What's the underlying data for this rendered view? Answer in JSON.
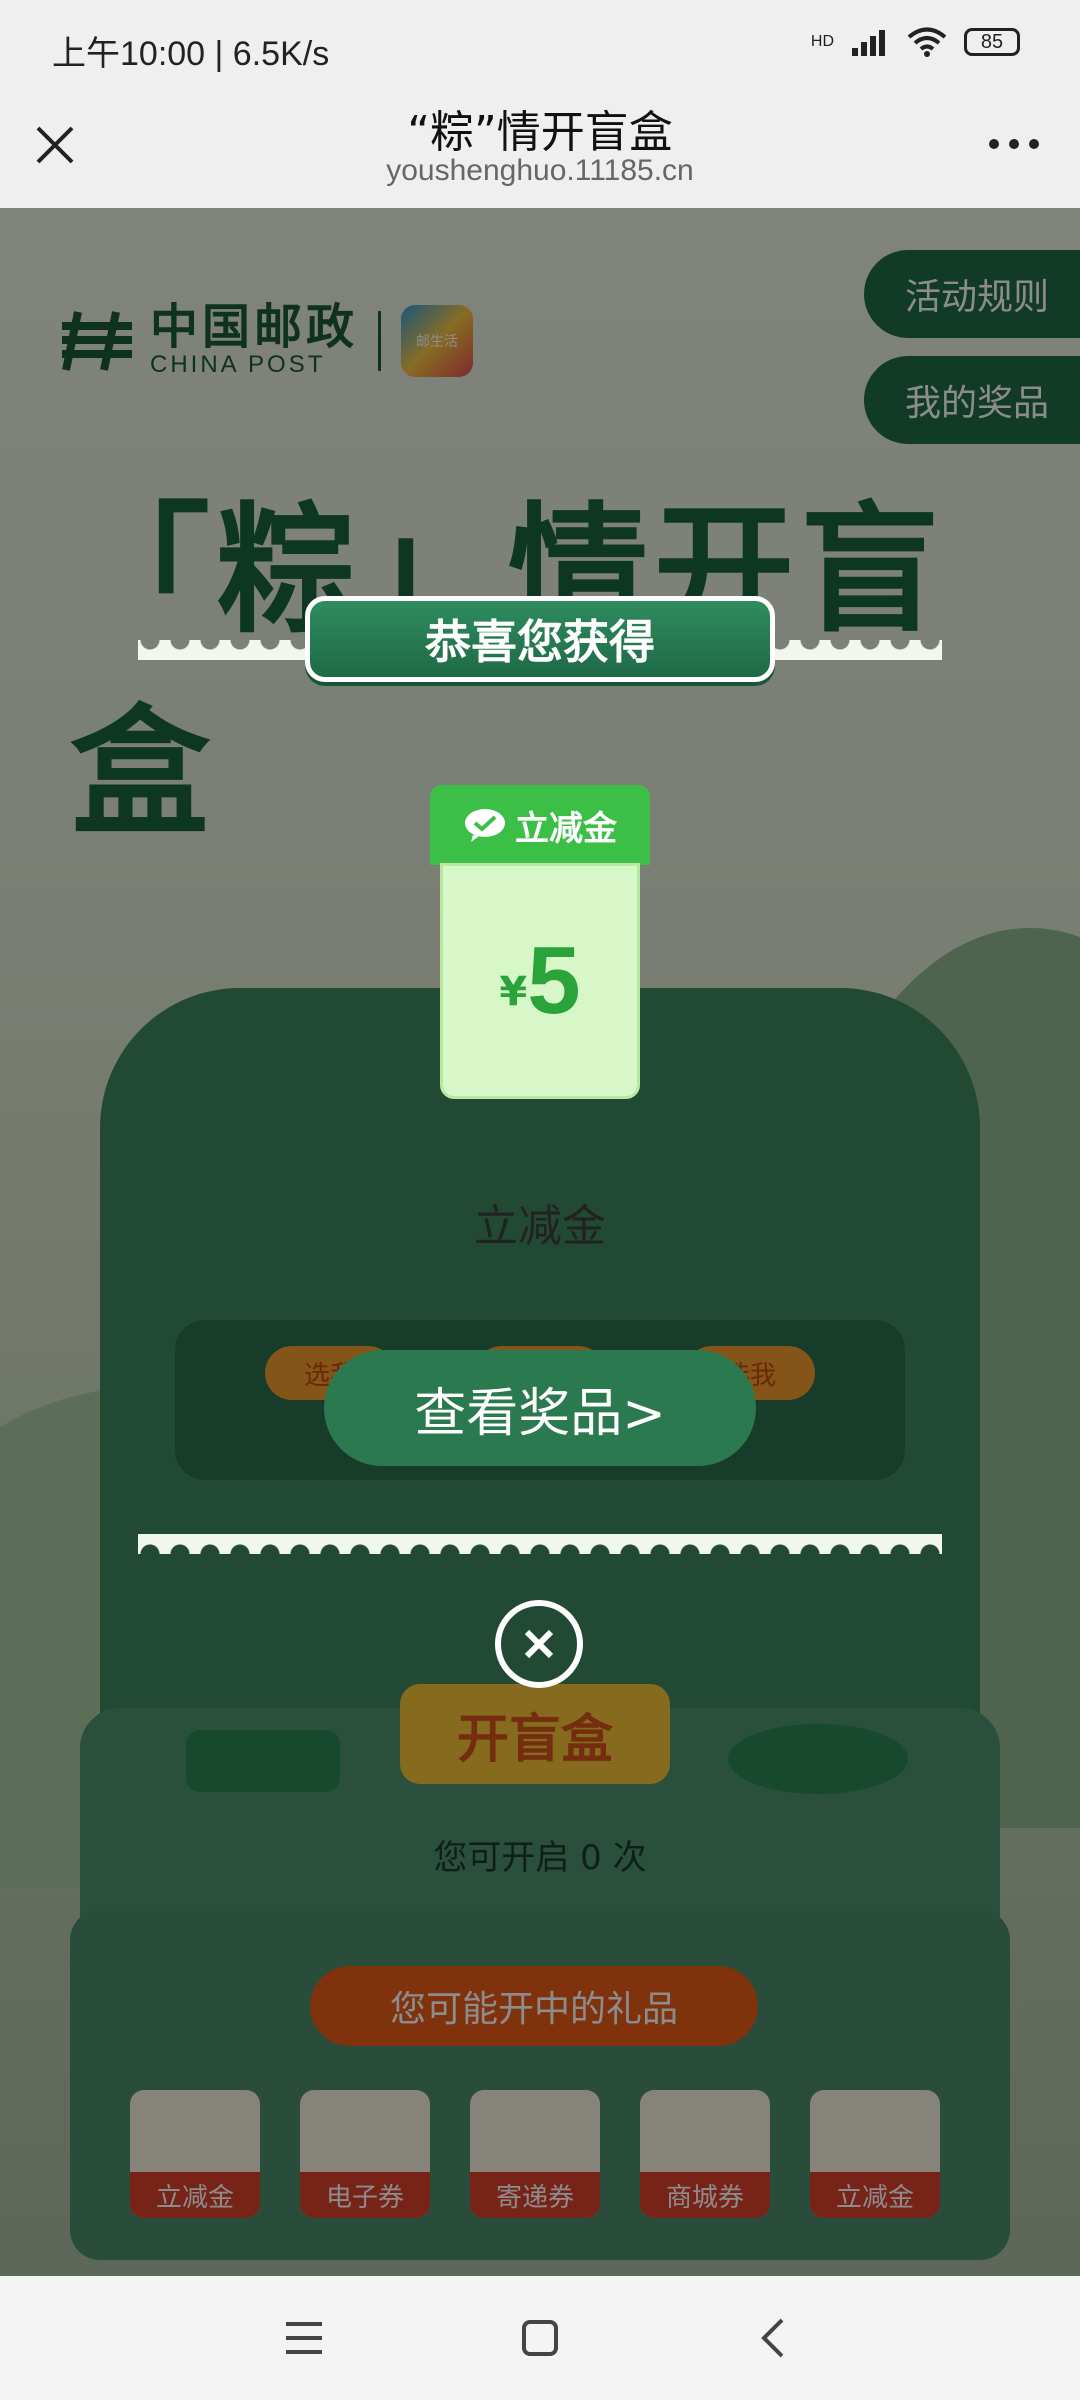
{
  "status_bar": {
    "time": "上午10:00 | 6.5K/s",
    "battery": "85",
    "network": "HD"
  },
  "titlebar": {
    "title": "“粽”情开盲盒",
    "url": "youshenghuo.11185.cn"
  },
  "logo": {
    "cn": "中国邮政",
    "en": "CHINA POST",
    "app": "邮生活"
  },
  "side_buttons": [
    "活动规则",
    "我的奖品"
  ],
  "page_title": "「粽」情开盲盒",
  "machine": {
    "pick_labels": [
      "选我",
      "选我",
      "选我"
    ],
    "open_button": "开盲盒",
    "count_text": "您可开启 0 次"
  },
  "gifts": {
    "title": "您可能开中的礼品",
    "items": [
      "立减金",
      "电子券",
      "寄递券",
      "商城券",
      "立减金"
    ]
  },
  "modal": {
    "ribbon": "恭喜您获得",
    "coupon_head": "立减金",
    "coupon_currency": "¥",
    "coupon_amount": "5",
    "prize_name": "立减金",
    "view_button": "查看奖品>"
  },
  "colors": {
    "primary_green": "#1f6a47",
    "coupon_green": "#3cbf47",
    "accent_orange": "#e85b16"
  }
}
